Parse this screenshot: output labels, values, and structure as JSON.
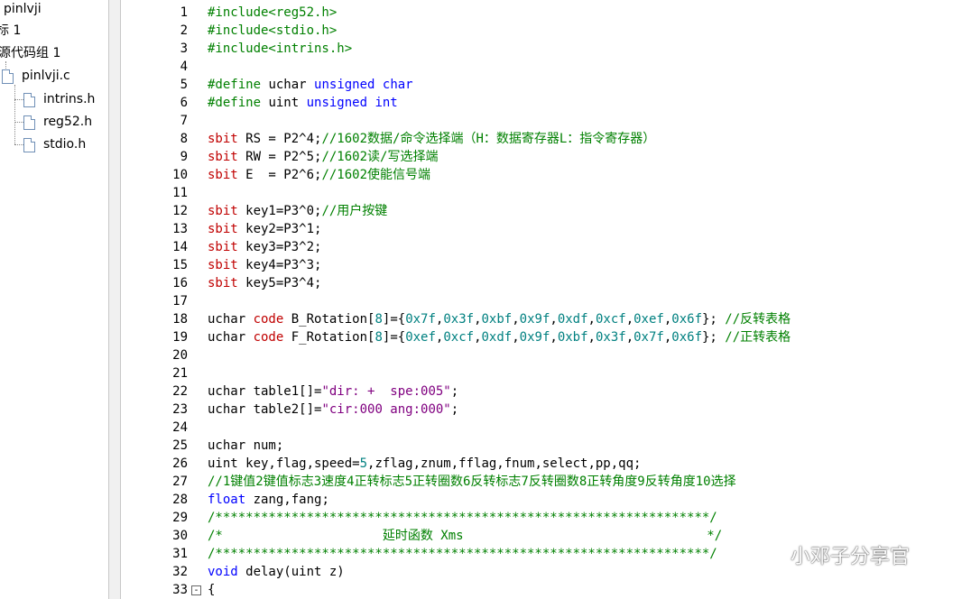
{
  "colors": {
    "preprocessor": "#008000",
    "keyword": "#0000ff",
    "sfr_keyword": "#c00000",
    "comment": "#008000",
    "string": "#800080",
    "number": "#008080",
    "plain": "#000000",
    "line_number": "#000000"
  },
  "project_tree": {
    "items": [
      {
        "label": "pinlvji"
      },
      {
        "label": "标 1"
      },
      {
        "label": "源代码组 1"
      },
      {
        "label": "pinlvji.c",
        "icon": "file-icon"
      },
      {
        "label": "intrins.h",
        "icon": "file-icon"
      },
      {
        "label": "reg52.h",
        "icon": "file-icon"
      },
      {
        "label": "stdio.h",
        "icon": "file-icon"
      }
    ]
  },
  "editor": {
    "lines": [
      {
        "n": "1",
        "tokens": [
          {
            "t": "#include<reg52.h>",
            "c": "preprocessor"
          }
        ]
      },
      {
        "n": "2",
        "tokens": [
          {
            "t": "#include<stdio.h>",
            "c": "preprocessor"
          }
        ]
      },
      {
        "n": "3",
        "tokens": [
          {
            "t": "#include<intrins.h>",
            "c": "preprocessor"
          }
        ]
      },
      {
        "n": "4",
        "tokens": []
      },
      {
        "n": "5",
        "tokens": [
          {
            "t": "#define",
            "c": "preprocessor"
          },
          {
            "t": " uchar ",
            "c": "plain"
          },
          {
            "t": "unsigned char",
            "c": "keyword"
          }
        ]
      },
      {
        "n": "6",
        "tokens": [
          {
            "t": "#define",
            "c": "preprocessor"
          },
          {
            "t": " uint ",
            "c": "plain"
          },
          {
            "t": "unsigned int",
            "c": "keyword"
          }
        ]
      },
      {
        "n": "7",
        "tokens": []
      },
      {
        "n": "8",
        "tokens": [
          {
            "t": "sbit",
            "c": "sfr_keyword"
          },
          {
            "t": " RS = P2^4;",
            "c": "plain"
          },
          {
            "t": "//1602数据/命令选择端（H：数据寄存器L：指令寄存器）",
            "c": "comment"
          }
        ]
      },
      {
        "n": "9",
        "tokens": [
          {
            "t": "sbit",
            "c": "sfr_keyword"
          },
          {
            "t": " RW = P2^5;",
            "c": "plain"
          },
          {
            "t": "//1602读/写选择端",
            "c": "comment"
          }
        ]
      },
      {
        "n": "10",
        "tokens": [
          {
            "t": "sbit",
            "c": "sfr_keyword"
          },
          {
            "t": " E  = P2^6;",
            "c": "plain"
          },
          {
            "t": "//1602使能信号端",
            "c": "comment"
          }
        ]
      },
      {
        "n": "11",
        "tokens": []
      },
      {
        "n": "12",
        "tokens": [
          {
            "t": "sbit",
            "c": "sfr_keyword"
          },
          {
            "t": " key1=P3^0;",
            "c": "plain"
          },
          {
            "t": "//用户按键",
            "c": "comment"
          }
        ]
      },
      {
        "n": "13",
        "tokens": [
          {
            "t": "sbit",
            "c": "sfr_keyword"
          },
          {
            "t": " key2=P3^1;",
            "c": "plain"
          }
        ]
      },
      {
        "n": "14",
        "tokens": [
          {
            "t": "sbit",
            "c": "sfr_keyword"
          },
          {
            "t": " key3=P3^2;",
            "c": "plain"
          }
        ]
      },
      {
        "n": "15",
        "tokens": [
          {
            "t": "sbit",
            "c": "sfr_keyword"
          },
          {
            "t": " key4=P3^3;",
            "c": "plain"
          }
        ]
      },
      {
        "n": "16",
        "tokens": [
          {
            "t": "sbit",
            "c": "sfr_keyword"
          },
          {
            "t": " key5=P3^4;",
            "c": "plain"
          }
        ]
      },
      {
        "n": "17",
        "tokens": []
      },
      {
        "n": "18",
        "tokens": [
          {
            "t": "uchar ",
            "c": "plain"
          },
          {
            "t": "code",
            "c": "sfr_keyword"
          },
          {
            "t": " B_Rotation[",
            "c": "plain"
          },
          {
            "t": "8",
            "c": "number"
          },
          {
            "t": "]={",
            "c": "plain"
          },
          {
            "t": "0x7f",
            "c": "number"
          },
          {
            "t": ",",
            "c": "plain"
          },
          {
            "t": "0x3f",
            "c": "number"
          },
          {
            "t": ",",
            "c": "plain"
          },
          {
            "t": "0xbf",
            "c": "number"
          },
          {
            "t": ",",
            "c": "plain"
          },
          {
            "t": "0x9f",
            "c": "number"
          },
          {
            "t": ",",
            "c": "plain"
          },
          {
            "t": "0xdf",
            "c": "number"
          },
          {
            "t": ",",
            "c": "plain"
          },
          {
            "t": "0xcf",
            "c": "number"
          },
          {
            "t": ",",
            "c": "plain"
          },
          {
            "t": "0xef",
            "c": "number"
          },
          {
            "t": ",",
            "c": "plain"
          },
          {
            "t": "0x6f",
            "c": "number"
          },
          {
            "t": "}; ",
            "c": "plain"
          },
          {
            "t": "//反转表格",
            "c": "comment"
          }
        ]
      },
      {
        "n": "19",
        "tokens": [
          {
            "t": "uchar ",
            "c": "plain"
          },
          {
            "t": "code",
            "c": "sfr_keyword"
          },
          {
            "t": " F_Rotation[",
            "c": "plain"
          },
          {
            "t": "8",
            "c": "number"
          },
          {
            "t": "]={",
            "c": "plain"
          },
          {
            "t": "0xef",
            "c": "number"
          },
          {
            "t": ",",
            "c": "plain"
          },
          {
            "t": "0xcf",
            "c": "number"
          },
          {
            "t": ",",
            "c": "plain"
          },
          {
            "t": "0xdf",
            "c": "number"
          },
          {
            "t": ",",
            "c": "plain"
          },
          {
            "t": "0x9f",
            "c": "number"
          },
          {
            "t": ",",
            "c": "plain"
          },
          {
            "t": "0xbf",
            "c": "number"
          },
          {
            "t": ",",
            "c": "plain"
          },
          {
            "t": "0x3f",
            "c": "number"
          },
          {
            "t": ",",
            "c": "plain"
          },
          {
            "t": "0x7f",
            "c": "number"
          },
          {
            "t": ",",
            "c": "plain"
          },
          {
            "t": "0x6f",
            "c": "number"
          },
          {
            "t": "}; ",
            "c": "plain"
          },
          {
            "t": "//正转表格",
            "c": "comment"
          }
        ]
      },
      {
        "n": "20",
        "tokens": []
      },
      {
        "n": "21",
        "tokens": []
      },
      {
        "n": "22",
        "tokens": [
          {
            "t": "uchar table1[]=",
            "c": "plain"
          },
          {
            "t": "\"dir: +  spe:005\"",
            "c": "string"
          },
          {
            "t": ";",
            "c": "plain"
          }
        ]
      },
      {
        "n": "23",
        "tokens": [
          {
            "t": "uchar table2[]=",
            "c": "plain"
          },
          {
            "t": "\"cir:000 ang:000\"",
            "c": "string"
          },
          {
            "t": ";",
            "c": "plain"
          }
        ]
      },
      {
        "n": "24",
        "tokens": []
      },
      {
        "n": "25",
        "tokens": [
          {
            "t": "uchar num;",
            "c": "plain"
          }
        ]
      },
      {
        "n": "26",
        "tokens": [
          {
            "t": "uint key,flag,speed=",
            "c": "plain"
          },
          {
            "t": "5",
            "c": "number"
          },
          {
            "t": ",zflag,znum,fflag,fnum,select,pp,qq;",
            "c": "plain"
          }
        ]
      },
      {
        "n": "27",
        "tokens": [
          {
            "t": "//1键值2键值标志3速度4正转标志5正转圈数6反转标志7反转圈数8正转角度9反转角度10选择",
            "c": "comment"
          }
        ]
      },
      {
        "n": "28",
        "tokens": [
          {
            "t": "float",
            "c": "keyword"
          },
          {
            "t": " zang,fang;",
            "c": "plain"
          }
        ]
      },
      {
        "n": "29",
        "tokens": [
          {
            "t": "/*****************************************************************/",
            "c": "comment"
          }
        ]
      },
      {
        "n": "30",
        "tokens": [
          {
            "t": "/*                     延时函数 Xms                                */",
            "c": "comment"
          }
        ]
      },
      {
        "n": "31",
        "tokens": [
          {
            "t": "/*****************************************************************/",
            "c": "comment"
          }
        ]
      },
      {
        "n": "32",
        "tokens": [
          {
            "t": "void",
            "c": "keyword"
          },
          {
            "t": " delay(uint z)",
            "c": "plain"
          }
        ]
      },
      {
        "n": "33",
        "tokens": [
          {
            "t": "{",
            "c": "plain"
          }
        ],
        "fold": "-"
      }
    ]
  },
  "watermark": {
    "text": "小邓子分享官",
    "icon": "wechat-icon"
  }
}
